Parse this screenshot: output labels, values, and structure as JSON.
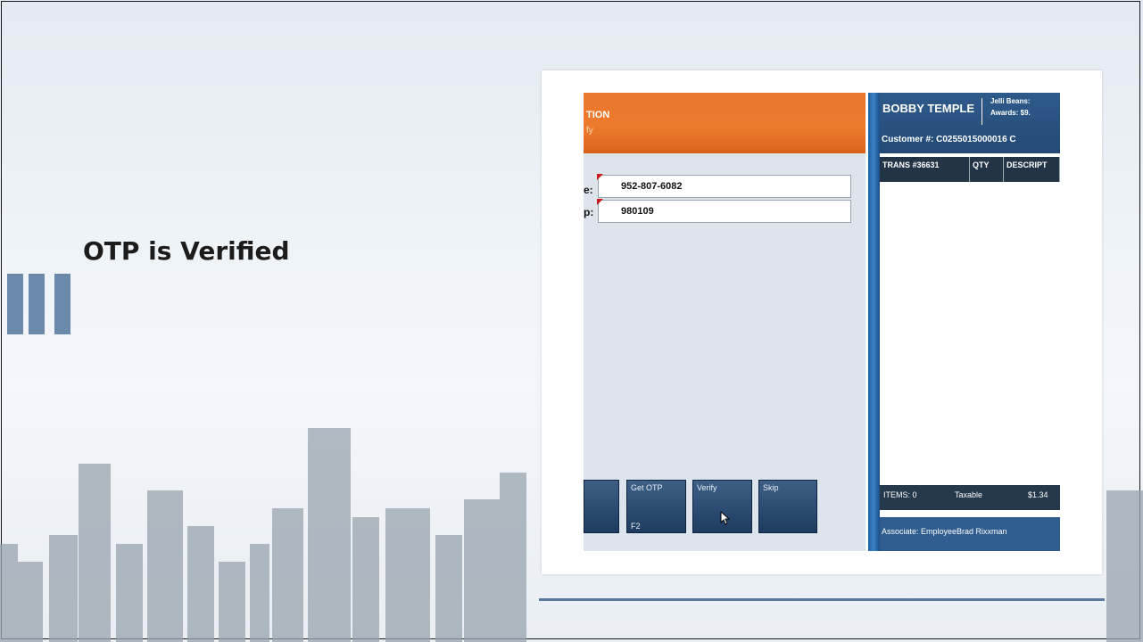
{
  "slide": {
    "title": "OTP is Verified"
  },
  "colors": {
    "accent_bars": "#6b89aa",
    "pos_orange": "#ed7a2c",
    "pos_navy": "#243447",
    "pos_blue": "#2f5d8f"
  },
  "pos": {
    "header": {
      "title_fragment": "TION",
      "subtitle_fragment": "fy"
    },
    "fields": [
      {
        "label_fragment": "e:",
        "value": "952-807-6082"
      },
      {
        "label_fragment": "p:",
        "value": "980109"
      }
    ],
    "function_keys": [
      {
        "label": "",
        "hotkey": ""
      },
      {
        "label": "Get OTP",
        "hotkey": "F2"
      },
      {
        "label": "Verify",
        "hotkey": ""
      },
      {
        "label": "Skip",
        "hotkey": ""
      }
    ],
    "customer": {
      "name": "BOBBY TEMPLE",
      "jelli_beans": "Jelli Beans:",
      "awards": "Awards: $9.",
      "number": "Customer #:  C0255015000016  C"
    },
    "table": {
      "columns": [
        "TRANS #36631",
        "QTY",
        "DESCRIPT"
      ]
    },
    "summary": {
      "items": "ITEMS:  0",
      "taxable_label": "Taxable",
      "taxable_value": "$1.34"
    },
    "associate": "Associate:  EmployeeBrad Rixxman",
    "icons": [
      "mouse-cursor-icon",
      "required-marker-icon"
    ]
  }
}
